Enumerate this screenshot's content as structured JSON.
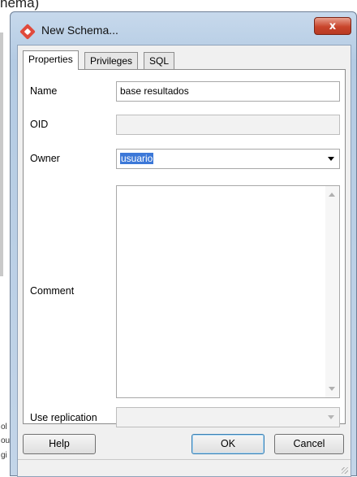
{
  "background": {
    "title_fragment": "hema)",
    "side_fragments": [
      "ol",
      "ou",
      "gi"
    ]
  },
  "window": {
    "title": "New Schema...",
    "close_label": "x"
  },
  "tabs": [
    {
      "label": "Properties",
      "active": true
    },
    {
      "label": "Privileges",
      "active": false
    },
    {
      "label": "SQL",
      "active": false
    }
  ],
  "form": {
    "name_label": "Name",
    "name_value": "base resultados",
    "oid_label": "OID",
    "oid_value": "",
    "owner_label": "Owner",
    "owner_value": "usuario",
    "comment_label": "Comment",
    "comment_value": "",
    "replication_label": "Use replication",
    "replication_value": ""
  },
  "buttons": {
    "help": "Help",
    "ok": "OK",
    "cancel": "Cancel"
  },
  "colors": {
    "selection": "#3c78d8",
    "close_button": "#c9452c",
    "app_icon": "#e04a3c"
  }
}
